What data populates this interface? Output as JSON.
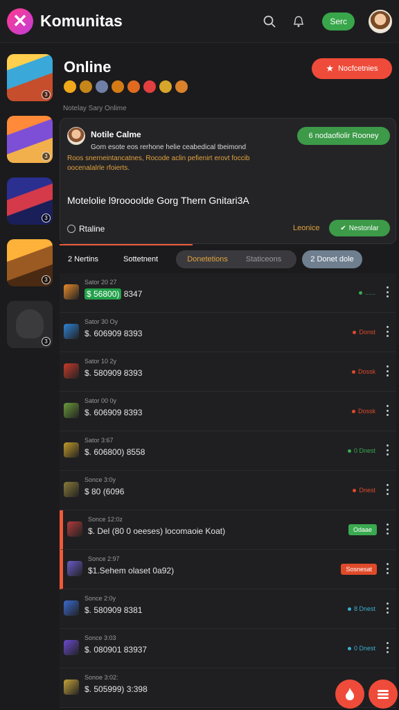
{
  "header": {
    "logo": "✕",
    "title": "Komunitas",
    "search_icon": "search-icon",
    "bell_icon": "bell-icon",
    "button_label": "Serc"
  },
  "sidebar": {
    "items": [
      {
        "num": "3"
      },
      {
        "num": "3"
      },
      {
        "num": "3"
      },
      {
        "num": "3"
      },
      {
        "num": "3"
      }
    ]
  },
  "online": {
    "title": "Online",
    "notif_button": "Nocfcetnies",
    "caption": "Notelay Sary Onlime",
    "emoji_colors": [
      "#f0a71c",
      "#c7861a",
      "#6f7fa6",
      "#d57b16",
      "#e06a1f",
      "#e24040",
      "#d6a52a",
      "#d9822b"
    ]
  },
  "card": {
    "name": "Notile Calme",
    "line1": "Gorn esote eos rerhone helie ceabedical tbeimond",
    "line2": "Roos snerneintancatnes, Rocode aclin pefienirt erovt foccib",
    "line3": "oocenalalrle rfoierts.",
    "green_button": "6 nodaofiolir Rooney",
    "headline": "Motelolie l9roooolde Gorg Thern Gnitari3A",
    "status": "Rtaline",
    "link": "Leonice",
    "button2": "Nestonlar"
  },
  "tabs": [
    {
      "label": "2 Nertins"
    },
    {
      "label": "Sottetnent"
    },
    {
      "label": "Donetetions"
    },
    {
      "label": "Staticeons"
    },
    {
      "label": "2 Donet dole"
    }
  ],
  "list": {
    "rows": [
      {
        "sub": "Sator 20 27",
        "chip": "$ 56800)",
        "main_rest": " 8347",
        "status": "......",
        "status_color": "#3aaa50",
        "icon_color": "#e88b2a"
      },
      {
        "sub": "Sator 30 Oy",
        "main": "$. 606909 8393",
        "status": "Donst",
        "status_color": "#e04a2a",
        "icon_color": "#2e82d6"
      },
      {
        "sub": "Sator 10 2y",
        "main": "$. 580909 8393",
        "status": "Dossk",
        "status_color": "#e04a2a",
        "icon_color": "#c83a2a"
      },
      {
        "sub": "Sator 00 0y",
        "main": "$. 606909 8393",
        "status": "Dossk",
        "status_color": "#e04a2a",
        "icon_color": "#6b9a3a"
      },
      {
        "sub": "Sator 3:67",
        "main": "$. 606800) 8558",
        "status": "0 Dnest",
        "status_color": "#3aaa50",
        "icon_color": "#c29a2a"
      },
      {
        "sub": "Sonce 3:0y",
        "main": "$ 80 (6096",
        "status": "Dnest",
        "status_color": "#e04a2a",
        "icon_color": "#8a7a3a"
      },
      {
        "sub": "Sonce 12:0z",
        "main": "$. Del (80 0 oeeses) locomaoie Koat)",
        "badge": "Odaae",
        "badge_color": "#3aaa50",
        "highlight": true,
        "icon_color": "#b03a3a"
      },
      {
        "sub": "Sonce 2:97",
        "main": "$1.Sehem olaset 0a92)",
        "badge": "Sosnesat",
        "badge_color": "#e04a2a",
        "highlight": true,
        "icon_color": "#6a5ac8"
      },
      {
        "sub": "Sonce 2:0y",
        "main": "$. 580909 8381",
        "status": "8 Dnest",
        "status_color": "#3ab0d0",
        "icon_color": "#3a6ad0"
      },
      {
        "sub": "Sonce 3:03",
        "main": "$. 080901 83937",
        "status": "0 Dnest",
        "status_color": "#3ab0d0",
        "icon_color": "#6a4ad0"
      },
      {
        "sub": "Sonoe 3:02:",
        "main": "$. 505999) 3:398",
        "icon_color": "#c4a23a"
      }
    ]
  },
  "fabs": {
    "left_icon": "flame-icon",
    "right_icon": "menu-icon"
  }
}
